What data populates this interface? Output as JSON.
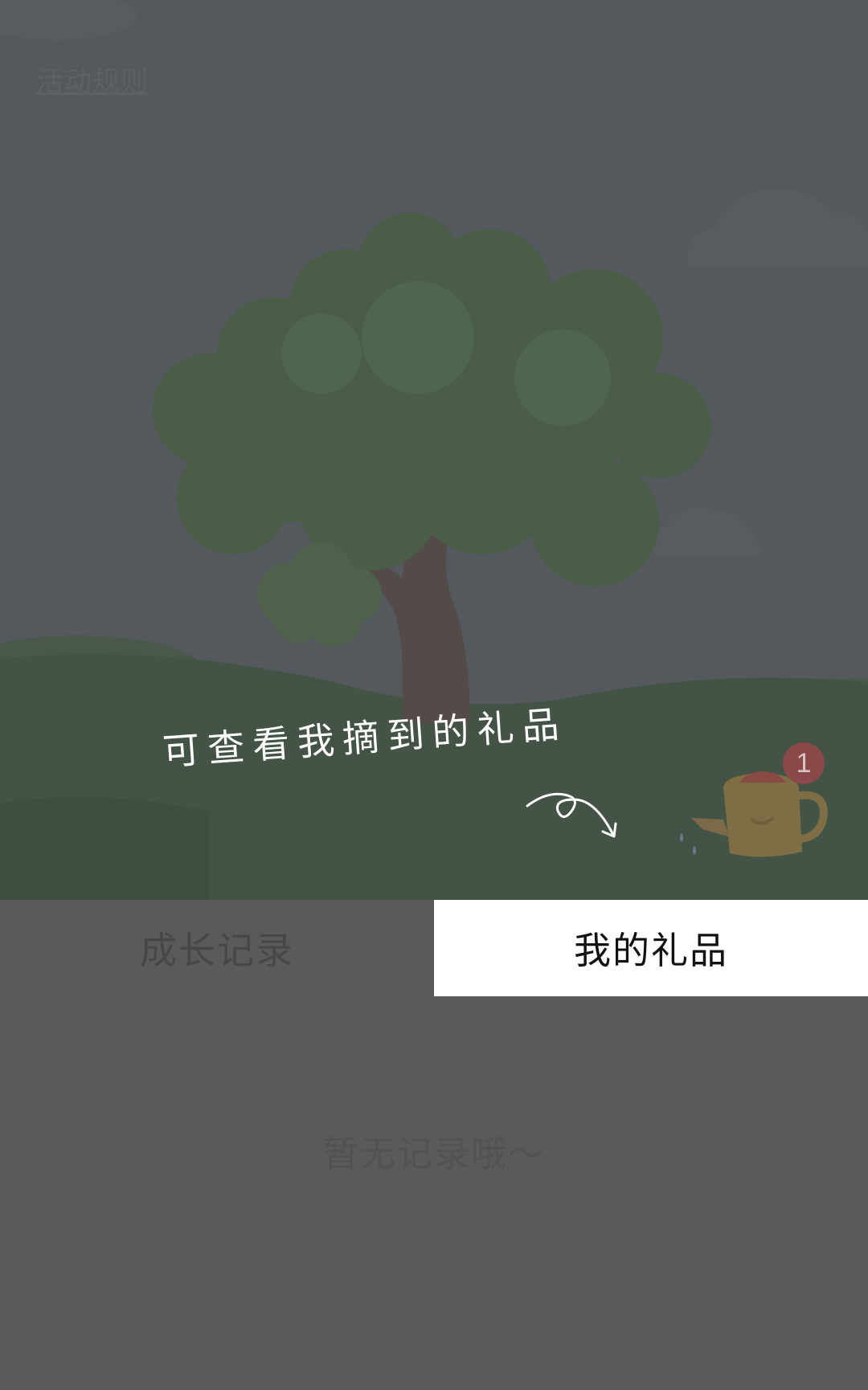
{
  "header": {
    "rules_link": "活动规则"
  },
  "guide": {
    "hint": "可查看我摘到的礼品",
    "arrow_icon": "curly-arrow-icon",
    "kettle_icon": "watering-can-icon",
    "kettle_badge": "1"
  },
  "tabs": [
    {
      "label": "成长记录",
      "active": false
    },
    {
      "label": "我的礼品",
      "active": true
    }
  ],
  "content": {
    "empty_text": "暂无记录哦～"
  },
  "colors": {
    "sky": "#53595d",
    "ground": "#435345",
    "overlay_bg": "#5a5a5a",
    "active_tab_bg": "#ffffff"
  }
}
